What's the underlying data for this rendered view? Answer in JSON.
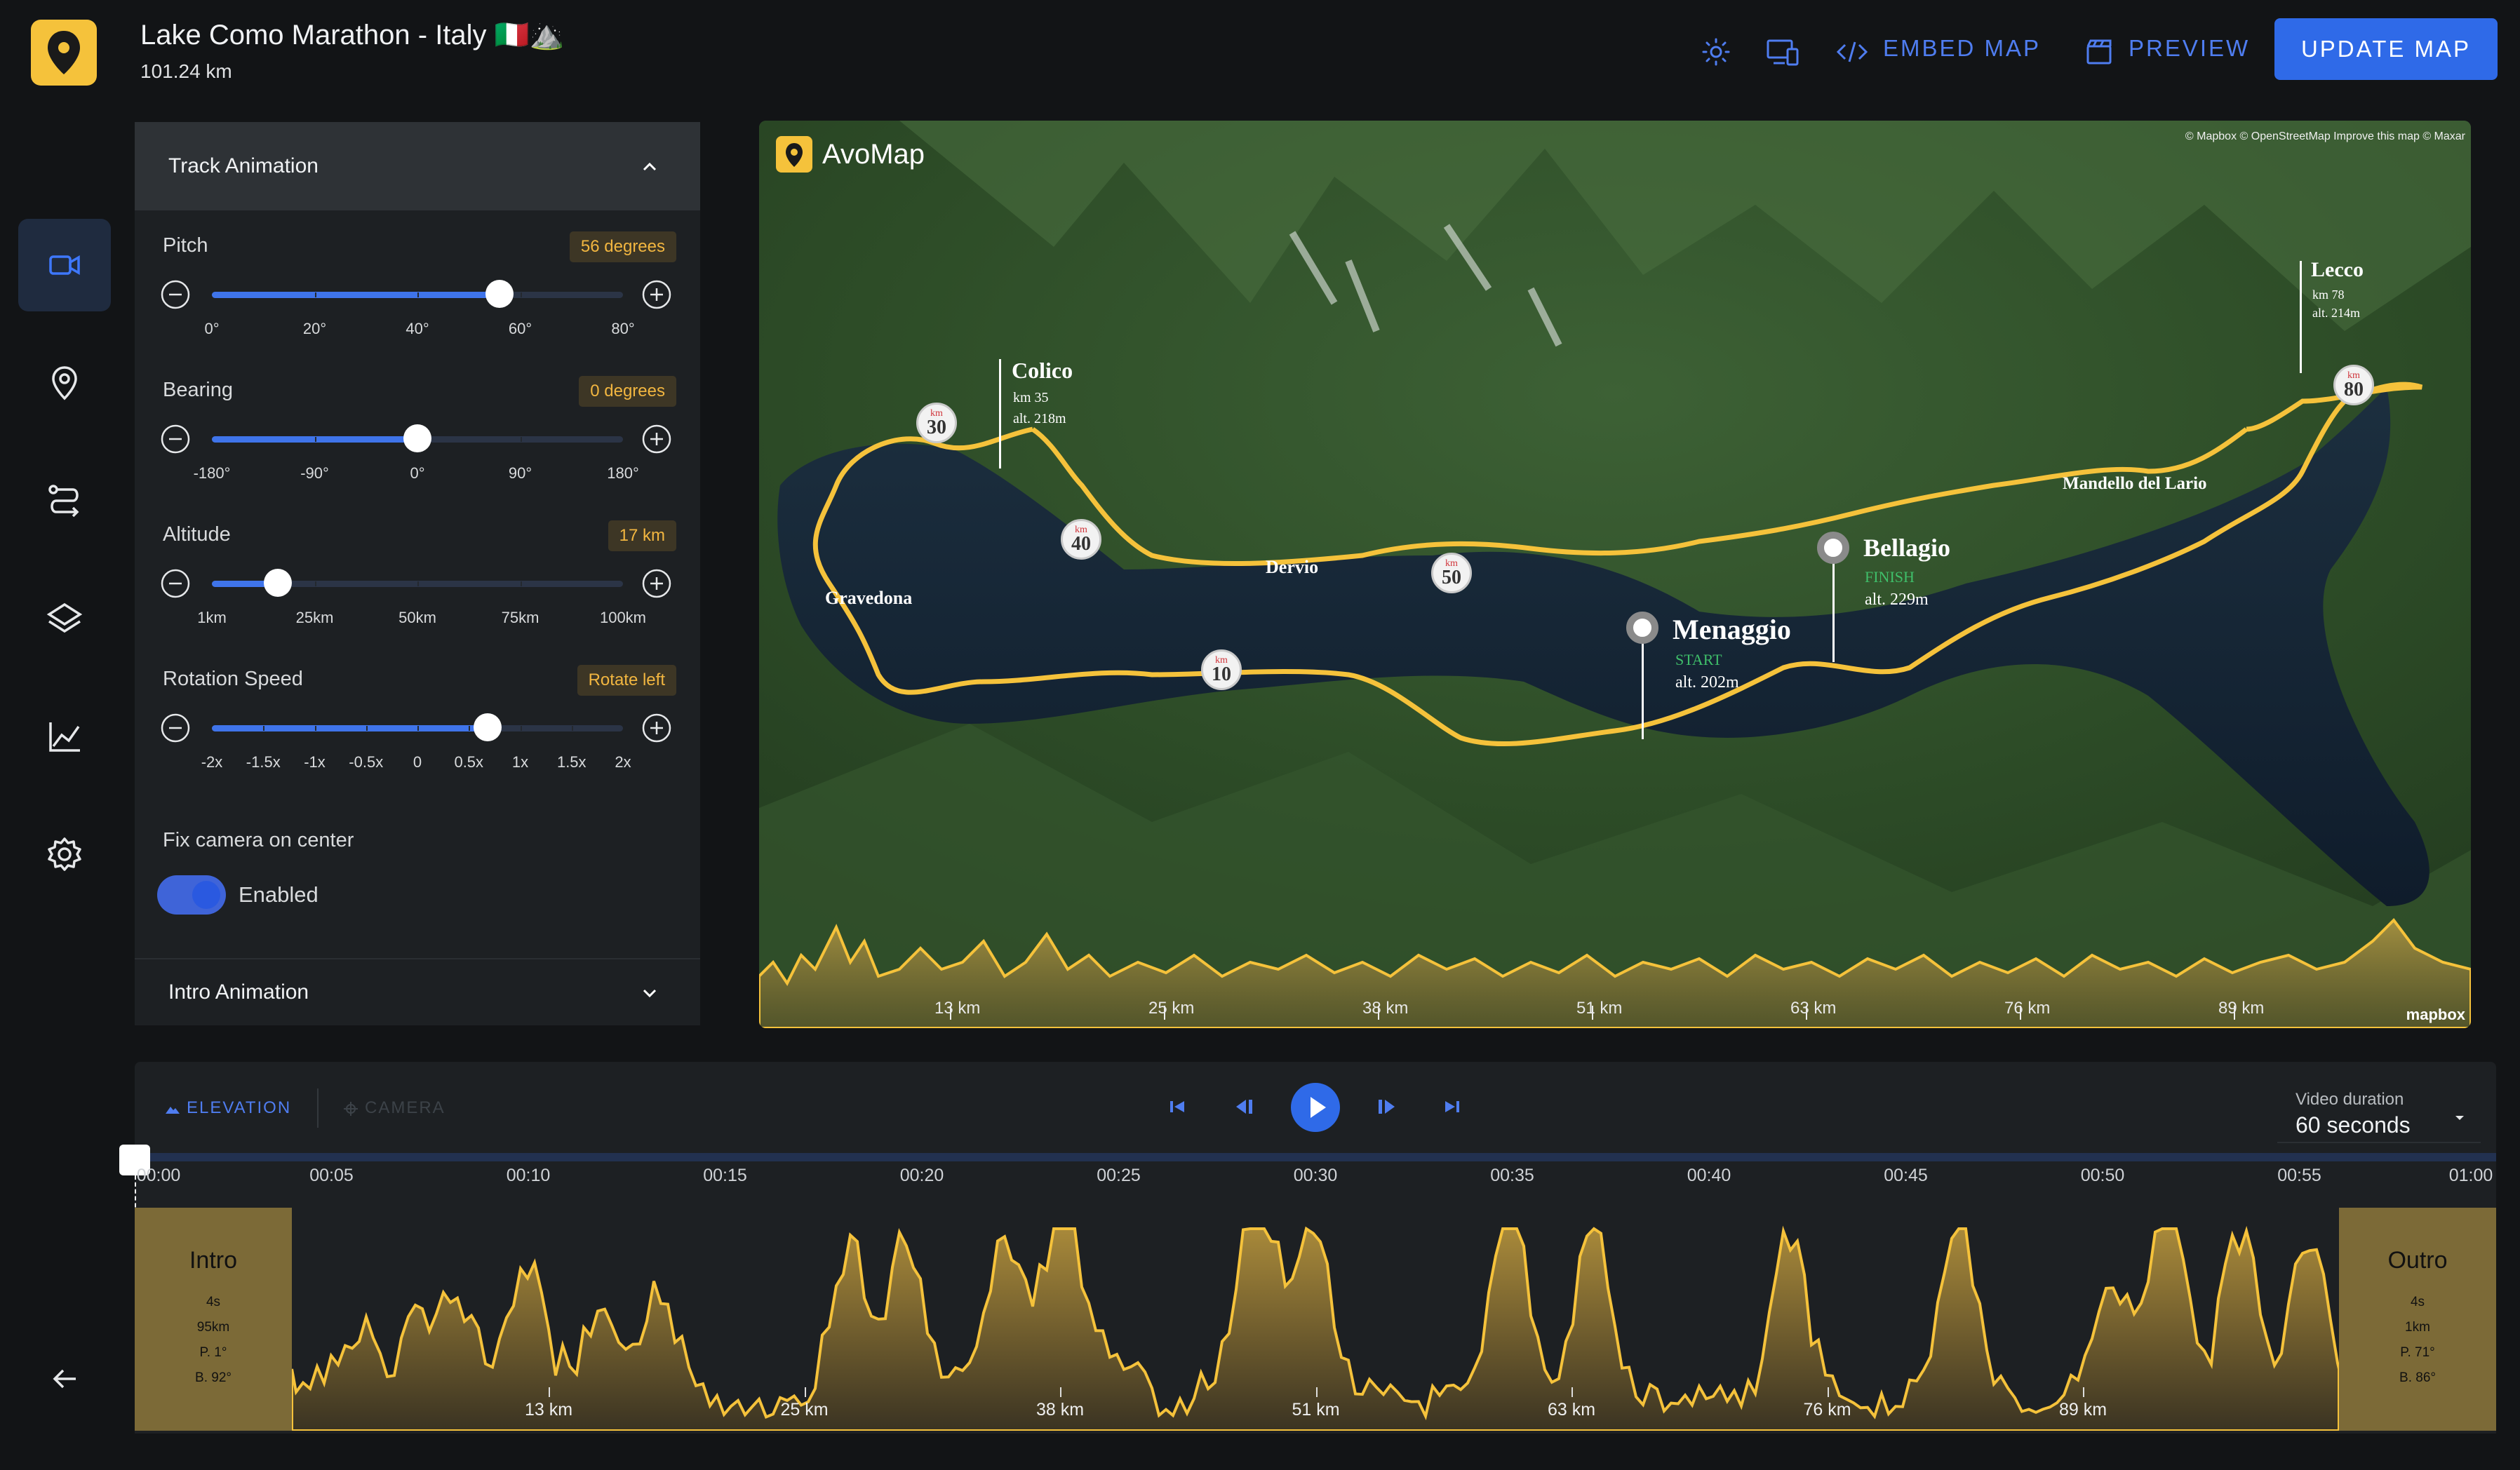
{
  "app": {
    "title": "Lake Como Marathon - Italy 🇮🇹⛰️",
    "distance": "101.24 km"
  },
  "toolbar": {
    "embed_label": "EMBED MAP",
    "preview_label": "PREVIEW",
    "update_label": "UPDATE MAP",
    "icons": [
      "sun-icon",
      "devices-icon",
      "code-icon",
      "clapperboard-icon"
    ]
  },
  "nav": {
    "items": [
      "camera-icon",
      "location-pin-icon",
      "route-icon",
      "layers-icon",
      "chart-icon",
      "settings-icon"
    ],
    "back_icon": "arrow-left-icon"
  },
  "panel": {
    "section_title": "Track Animation",
    "controls": [
      {
        "label": "Pitch",
        "badge": "56 degrees",
        "ticks": [
          "0°",
          "20°",
          "40°",
          "60°",
          "80°"
        ],
        "value_fraction": 0.7
      },
      {
        "label": "Bearing",
        "badge": "0 degrees",
        "ticks": [
          "-180°",
          "-90°",
          "0°",
          "90°",
          "180°"
        ],
        "value_fraction": 0.5
      },
      {
        "label": "Altitude",
        "badge": "17 km",
        "ticks": [
          "1km",
          "25km",
          "50km",
          "75km",
          "100km"
        ],
        "value_fraction": 0.16
      },
      {
        "label": "Rotation Speed",
        "badge": "Rotate left",
        "ticks": [
          "-2x",
          "-1.5x",
          "-1x",
          "-0.5x",
          "0",
          "0.5x",
          "1x",
          "1.5x",
          "2x"
        ],
        "value_fraction": 0.67
      }
    ],
    "fix_camera_label": "Fix camera on center",
    "toggle_label": "Enabled",
    "toggle_on": true,
    "intro_title": "Intro Animation"
  },
  "map": {
    "brand": "AvoMap",
    "attribution": "© Mapbox © OpenStreetMap Improve this map © Maxar",
    "mapbox_logo": "mapbox",
    "places": [
      {
        "name": "Colico",
        "sub1": "km 35",
        "sub2": "alt. 218m"
      },
      {
        "name": "Lecco",
        "sub1": "km 78",
        "sub2": "alt. 214m"
      },
      {
        "name": "Menaggio",
        "sub1": "START",
        "sub2": "alt. 202m"
      },
      {
        "name": "Bellagio",
        "sub1": "FINISH",
        "sub2": "alt. 229m"
      },
      {
        "name": "Gravedona"
      },
      {
        "name": "Dervio"
      },
      {
        "name": "Mandello del Lario"
      }
    ],
    "km_markers": [
      {
        "unit": "km",
        "value": "30"
      },
      {
        "unit": "km",
        "value": "40"
      },
      {
        "unit": "km",
        "value": "50"
      },
      {
        "unit": "km",
        "value": "10"
      },
      {
        "unit": "km",
        "value": "80"
      }
    ],
    "axis_labels": [
      "13 km",
      "25 km",
      "38 km",
      "51 km",
      "63 km",
      "76 km",
      "89 km"
    ]
  },
  "timeline": {
    "tabs": {
      "elevation": "ELEVATION",
      "camera": "CAMERA"
    },
    "controls": [
      "skip-start-icon",
      "step-back-icon",
      "play-icon",
      "step-forward-icon",
      "skip-end-icon"
    ],
    "video_duration_label": "Video duration",
    "video_duration_value": "60 seconds",
    "time_labels": [
      "00:00",
      "00:05",
      "00:10",
      "00:15",
      "00:20",
      "00:25",
      "00:30",
      "00:35",
      "00:40",
      "00:45",
      "00:50",
      "00:55",
      "01:00"
    ],
    "elevation_labels": [
      "13 km",
      "25 km",
      "38 km",
      "51 km",
      "63 km",
      "76 km",
      "89 km"
    ],
    "intro": {
      "title": "Intro",
      "lines": [
        "4s",
        "95km",
        "P. 1°",
        "B. 92°"
      ]
    },
    "outro": {
      "title": "Outro",
      "lines": [
        "4s",
        "1km",
        "P. 71°",
        "B. 86°"
      ]
    }
  },
  "colors": {
    "accent": "#2f6ae8",
    "track": "#f5c23b",
    "badge_text": "#f2b640",
    "panel": "#1d2023",
    "background": "#121416"
  }
}
